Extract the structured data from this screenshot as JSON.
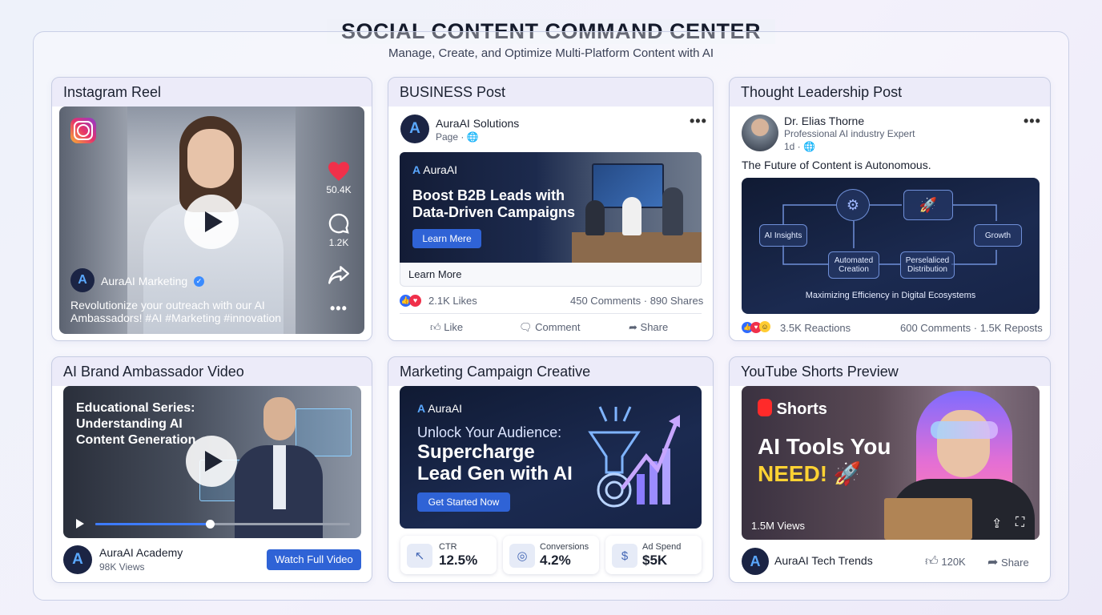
{
  "header": {
    "title": "SOCIAL CONTENT COMMAND CENTER",
    "subtitle": "Manage, Create, and Optimize Multi-Platform Content with AI"
  },
  "instagram": {
    "card_title": "Instagram Reel",
    "likes": "50.4K",
    "comments": "1.2K",
    "account": "AuraAI Marketing",
    "caption_line1": "Revolutionize your outreach with our AI",
    "caption_line2": "Ambassadors! #AI #Marketing #innovation"
  },
  "business": {
    "card_title": "BUSINESS Post",
    "page_name": "AuraAI Solutions",
    "page_meta": "Page ·",
    "brand": "AuraAI",
    "headline_line1": "Boost B2B Leads with",
    "headline_line2": "Data-Driven Campaigns",
    "image_button": "Learn Mere",
    "cta": "Learn More",
    "likes": "2.1K Likes",
    "comments_shares": "450 Comments · 890 Shares",
    "actions": {
      "like": "Like",
      "comment": "Comment",
      "share": "Share"
    }
  },
  "thought": {
    "card_title": "Thought Leadership Post",
    "author": "Dr. Elias Thorne",
    "author_title": "Professional AI industry Expert",
    "time": "1d ·",
    "post_text": "The Future of Content is Autonomous.",
    "flow": {
      "insights": "AI Insights",
      "automated_line1": "Automated",
      "automated_line2": "Creation",
      "personalized_line1": "Perselaliced",
      "personalized_line2": "Distribution",
      "growth": "Growth",
      "caption": "Maximizing Efficiency in Digital Ecosystems"
    },
    "reactions": "3.5K Reactions",
    "comments_reposts": "600 Comments · 1.5K Reposts"
  },
  "ambassador": {
    "card_title": "AI Brand Ambassador Video",
    "overlay_line1": "Educational Series:",
    "overlay_line2": "Understanding AI",
    "overlay_line3": "Content Generation",
    "progress": 0.45,
    "channel": "AuraAI Academy",
    "views": "98K Views",
    "button": "Watch Full Video"
  },
  "campaign": {
    "card_title": "Marketing Campaign Creative",
    "brand": "AuraAI",
    "line1": "Unlock Your Audience:",
    "line2": "Supercharge",
    "line3": "Lead Gen with AI",
    "button": "Get Started Now",
    "stats": [
      {
        "label": "CTR",
        "value": "12.5%"
      },
      {
        "label": "Conversions",
        "value": "4.2%"
      },
      {
        "label": "Ad Spend",
        "value": "$5K"
      }
    ]
  },
  "youtube": {
    "card_title": "YouTube Shorts Preview",
    "shorts_label": "Shorts",
    "title_line1": "AI Tools You",
    "title_line2": "NEED!",
    "views": "1.5M Views",
    "channel": "AuraAI Tech Trends",
    "likes": "120K",
    "share": "Share"
  },
  "colors": {
    "accent": "#2f63d6",
    "dark_panel": "#14203f",
    "card_header": "#ecebf9",
    "shorts_red": "#ff2a2a",
    "need_yellow": "#ffd233"
  }
}
